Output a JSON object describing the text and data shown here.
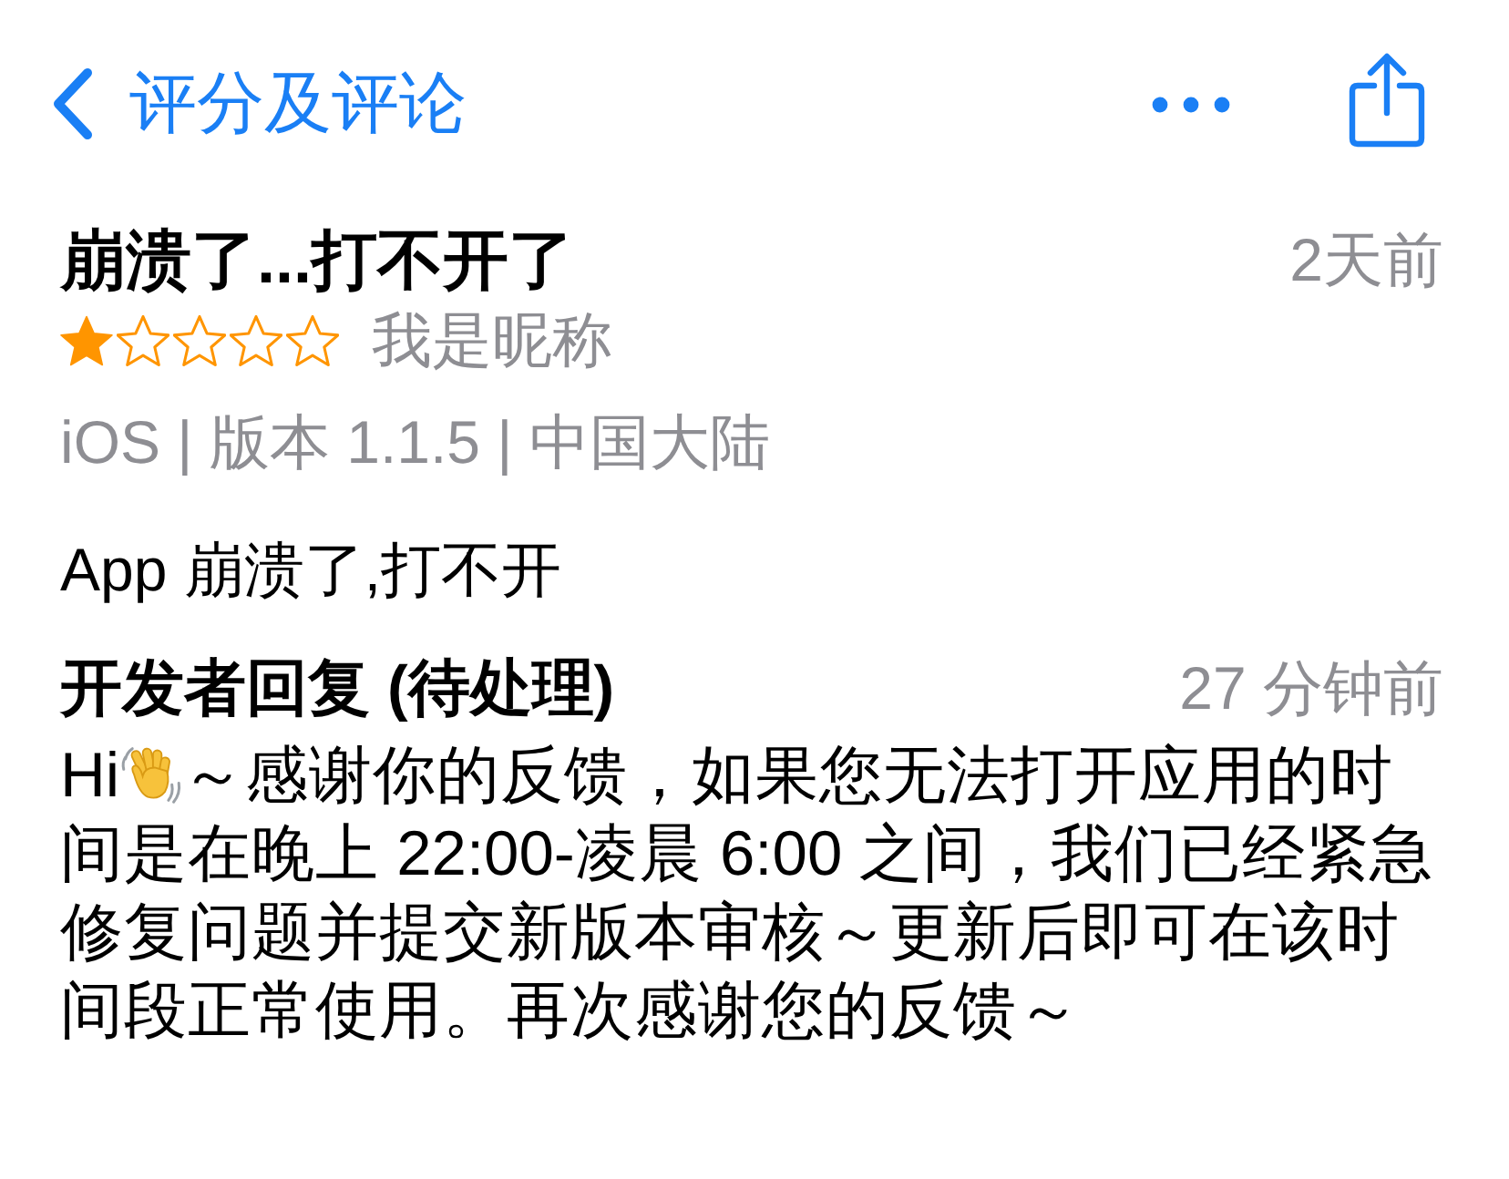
{
  "nav": {
    "back_label": "评分及评论"
  },
  "review": {
    "title": "崩溃了...打不开了",
    "date": "2天前",
    "stars": 1,
    "author": "我是昵称",
    "meta": "iOS | 版本 1.1.5 | 中国大陆",
    "body": "App 崩溃了,打不开"
  },
  "developer_reply": {
    "heading": "开发者回复 (待处理)",
    "date": "27 分钟前",
    "greeting": "Hi",
    "body": "～感谢你的反馈，如果您无法打开应用的时间是在晚上 22:00-凌晨 6:00 之间，我们已经紧急修复问题并提交新版本审核～更新后即可在该时间段正常使用。再次感谢您的反馈～"
  }
}
